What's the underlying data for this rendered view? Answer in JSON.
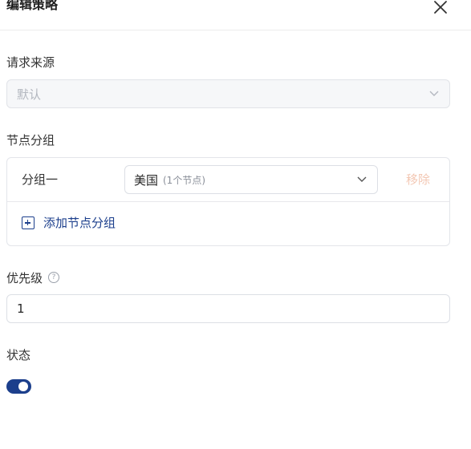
{
  "dialog": {
    "title": "编辑策略",
    "close_icon": "close-icon"
  },
  "request_source": {
    "label": "请求来源",
    "value": "默认"
  },
  "node_groups": {
    "label": "节点分组",
    "groups": [
      {
        "name": "分组一",
        "selected": "美国",
        "selected_note": "(1个节点)",
        "remove_label": "移除"
      }
    ],
    "add_label": "添加节点分组"
  },
  "priority": {
    "label": "优先级",
    "help_icon": "question-circle-icon",
    "value": "1"
  },
  "status": {
    "label": "状态",
    "enabled": true
  }
}
